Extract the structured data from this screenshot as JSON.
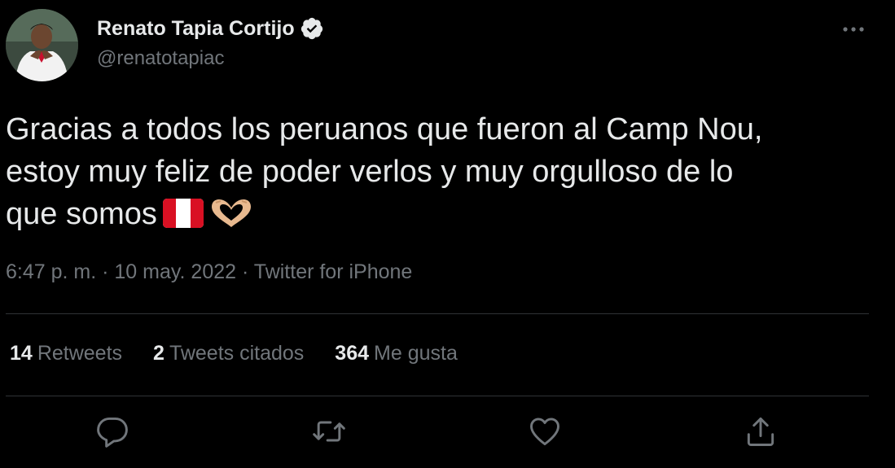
{
  "author": {
    "display_name": "Renato Tapia Cortijo",
    "handle": "@renatotapiac",
    "verified": true
  },
  "tweet": {
    "lines": [
      "Gracias a todos los peruanos que fueron al Camp Nou,",
      "estoy muy feliz de poder verlos y muy orgulloso de lo",
      "que somos"
    ],
    "emojis": [
      "flag-peru",
      "heart-hands"
    ]
  },
  "meta": {
    "time": "6:47 p. m.",
    "separator": " · ",
    "date": "10 may. 2022",
    "source": "Twitter for iPhone"
  },
  "stats": {
    "retweets": {
      "count": "14",
      "label": "Retweets"
    },
    "quotes": {
      "count": "2",
      "label": "Tweets citados"
    },
    "likes": {
      "count": "364",
      "label": "Me gusta"
    }
  },
  "icons": {
    "more": "more-horizontal-icon",
    "reply": "reply-icon",
    "retweet": "retweet-icon",
    "like": "heart-icon",
    "share": "share-icon",
    "verified": "verified-badge-icon"
  },
  "colors": {
    "background": "#000000",
    "text_primary": "#e7e9ea",
    "text_secondary": "#71767b",
    "divider": "#2f3336",
    "verified_badge": "#e7e9ea"
  }
}
